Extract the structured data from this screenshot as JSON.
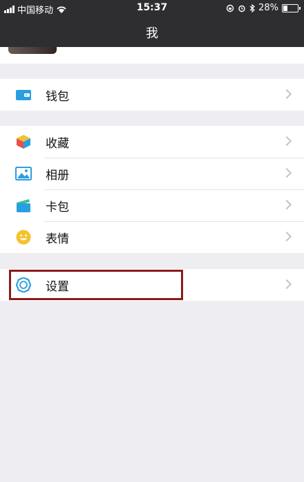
{
  "status_bar": {
    "carrier": "中国移动",
    "time": "15:37",
    "battery": "28%",
    "battery_level": 0.28
  },
  "header": {
    "title": "我"
  },
  "menu_groups": [
    [
      {
        "label": "钱包",
        "icon": "wallet-icon"
      }
    ],
    [
      {
        "label": "收藏",
        "icon": "favorites-cube-icon"
      },
      {
        "label": "相册",
        "icon": "album-image-icon"
      },
      {
        "label": "卡包",
        "icon": "card-wallet-icon"
      },
      {
        "label": "表情",
        "icon": "emoji-smile-icon"
      }
    ],
    [
      {
        "label": "设置",
        "icon": "settings-gear-icon"
      }
    ]
  ],
  "colors": {
    "header_bg": "#2e2e31",
    "page_bg": "#eeeef2",
    "highlight_border": "#8b1a1a",
    "accent_blue": "#2a9fe0"
  }
}
